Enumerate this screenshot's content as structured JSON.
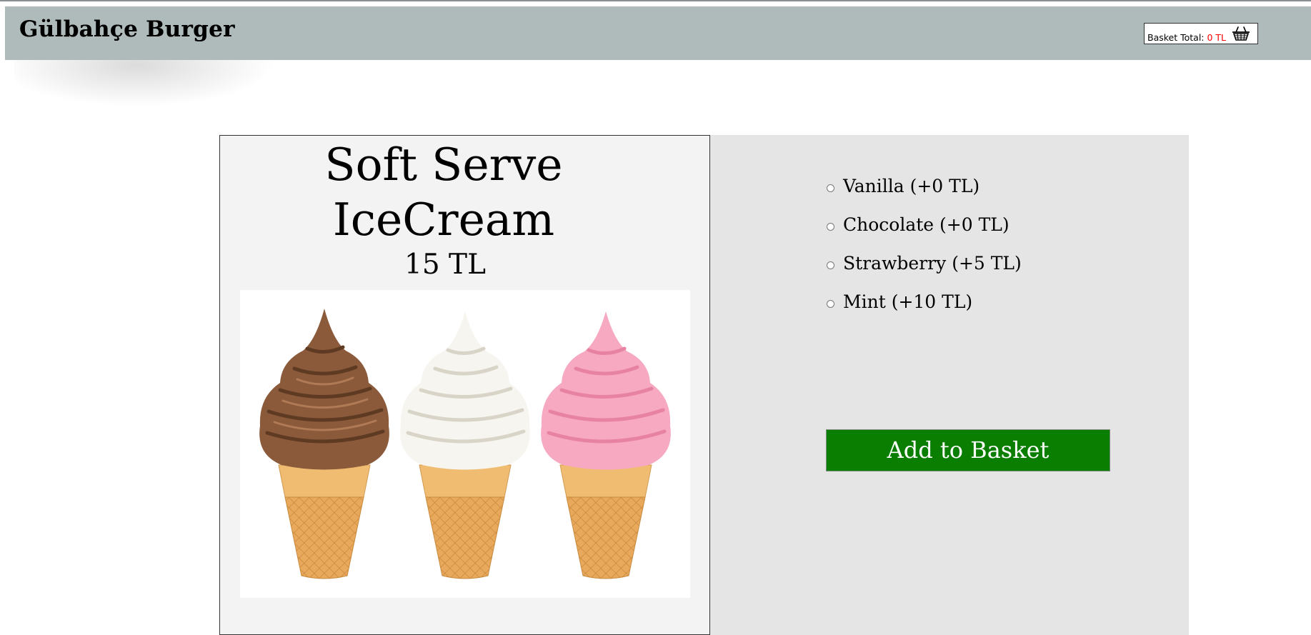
{
  "header": {
    "brand": "Gülbahçe Burger",
    "basket_label": "Basket Total: ",
    "basket_total": "0 TL",
    "basket_icon": "basket-icon"
  },
  "product": {
    "name": "Soft Serve IceCream",
    "price": "15 TL",
    "image": "three-soft-serve-cones-image"
  },
  "options": [
    {
      "label": "Vanilla (+0 TL)",
      "selected": false
    },
    {
      "label": "Chocolate (+0 TL)",
      "selected": false
    },
    {
      "label": "Strawberry (+5 TL)",
      "selected": false
    },
    {
      "label": "Mint (+10 TL)",
      "selected": false
    }
  ],
  "actions": {
    "add_to_basket": "Add to Basket"
  },
  "colors": {
    "header_bg": "#afbaba",
    "button_bg": "#097e00",
    "basket_total": "#ff0000",
    "card_left_bg": "#f3f3f3",
    "card_right_bg": "#e5e5e5"
  }
}
